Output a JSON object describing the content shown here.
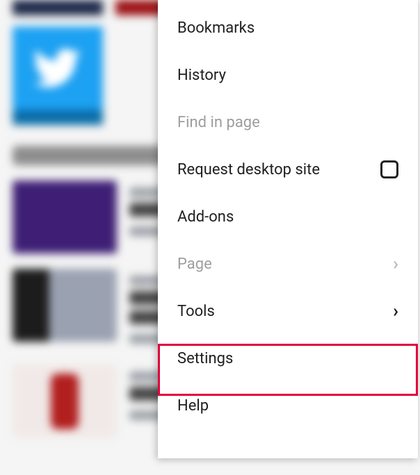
{
  "menu": {
    "items": [
      {
        "label": "Bookmarks",
        "enabled": true,
        "type": "plain"
      },
      {
        "label": "History",
        "enabled": true,
        "type": "plain"
      },
      {
        "label": "Find in page",
        "enabled": false,
        "type": "plain"
      },
      {
        "label": "Request desktop site",
        "enabled": true,
        "type": "checkbox",
        "checked": false
      },
      {
        "label": "Add-ons",
        "enabled": true,
        "type": "plain"
      },
      {
        "label": "Page",
        "enabled": false,
        "type": "submenu"
      },
      {
        "label": "Tools",
        "enabled": true,
        "type": "submenu"
      },
      {
        "label": "Settings",
        "enabled": true,
        "type": "plain"
      },
      {
        "label": "Help",
        "enabled": true,
        "type": "plain"
      }
    ]
  },
  "annotation": {
    "highlighted_item_index": 7
  }
}
